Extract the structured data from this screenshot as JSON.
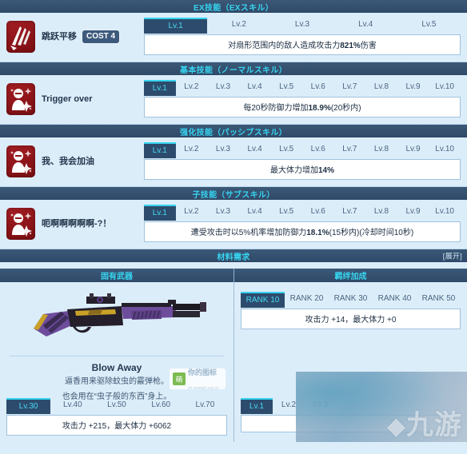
{
  "sections": {
    "ex": {
      "header": "EX技能（EXスキル）",
      "skill": {
        "name": "跳跃平移",
        "cost_label": "COST 4",
        "icon": "slash-impact-icon",
        "levels": [
          "Lv.1",
          "Lv.2",
          "Lv.3",
          "Lv.4",
          "Lv.5"
        ],
        "active_level": "Lv.1",
        "description_pre": "对扇形范围内的敌人造成攻击力",
        "description_value": "821%",
        "description_post": "伤害"
      }
    },
    "normal": {
      "header": "基本技能（ノーマルスキル）",
      "skill": {
        "name": "Trigger over",
        "icon": "student-sparkle-icon",
        "levels": [
          "Lv.1",
          "Lv.2",
          "Lv.3",
          "Lv.4",
          "Lv.5",
          "Lv.6",
          "Lv.7",
          "Lv.8",
          "Lv.9",
          "Lv.10"
        ],
        "active_level": "Lv.1",
        "description_pre": "每20秒防御力增加",
        "description_value": "18.9%",
        "description_post": "(20秒内)"
      }
    },
    "passive": {
      "header": "强化技能（パッシブスキル）",
      "skill": {
        "name": "我、我会加油",
        "icon": "student-sparkle-icon",
        "levels": [
          "Lv.1",
          "Lv.2",
          "Lv.3",
          "Lv.4",
          "Lv.5",
          "Lv.6",
          "Lv.7",
          "Lv.8",
          "Lv.9",
          "Lv.10"
        ],
        "active_level": "Lv.1",
        "description_pre": "最大体力增加",
        "description_value": "14%",
        "description_post": ""
      }
    },
    "sub": {
      "header": "子技能（サブスキル）",
      "skill": {
        "name": "呃啊啊啊啊啊-?！",
        "icon": "student-sparkle-icon",
        "levels": [
          "Lv.1",
          "Lv.2",
          "Lv.3",
          "Lv.4",
          "Lv.5",
          "Lv.6",
          "Lv.7",
          "Lv.8",
          "Lv.9",
          "Lv.10"
        ],
        "active_level": "Lv.1",
        "description_pre": "遭受攻击时以5%机率增加防御力",
        "description_value": "18.1%",
        "description_post": "(15秒内)(冷却时间10秒)"
      }
    }
  },
  "material": {
    "header": "材料需求",
    "expand_label": "[展开]",
    "columns": {
      "weapon": {
        "header": "固有武器",
        "name": "Blow Away",
        "desc_line1": "逼香用来驱除蚊虫的霰弹枪。",
        "desc_line2": "也会用在“虫子般的东西”身上。",
        "watermark_tag": "萌",
        "watermark_text": "你的图标",
        "watermark_sub": "zh.moegirl.org.cn",
        "levels": [
          "Lv.30",
          "Lv.40",
          "Lv.50",
          "Lv.60",
          "Lv.70"
        ],
        "active_level": "Lv.30",
        "stats": "攻击力 +215，最大体力 +6062"
      },
      "bond": {
        "header": "羁绊加成",
        "ranks": [
          "RANK 10",
          "RANK 20",
          "RANK 30",
          "RANK 40",
          "RANK 50"
        ],
        "active_rank": "RANK 10",
        "stats": "攻击力 +14，最大体力 +0",
        "levels": [
          "Lv.1",
          "Lv.2",
          "Lv.3"
        ],
        "active_level": "Lv.1"
      }
    }
  },
  "overlay_watermark": "九游",
  "colors": {
    "header_bar": "#2f4a68",
    "header_text": "#37d4f0",
    "page_bg": "#dcedfa",
    "active_tab_bg": "#2d4c6d",
    "accent": "#37d4f0",
    "skill_icon": "#8e1519"
  }
}
